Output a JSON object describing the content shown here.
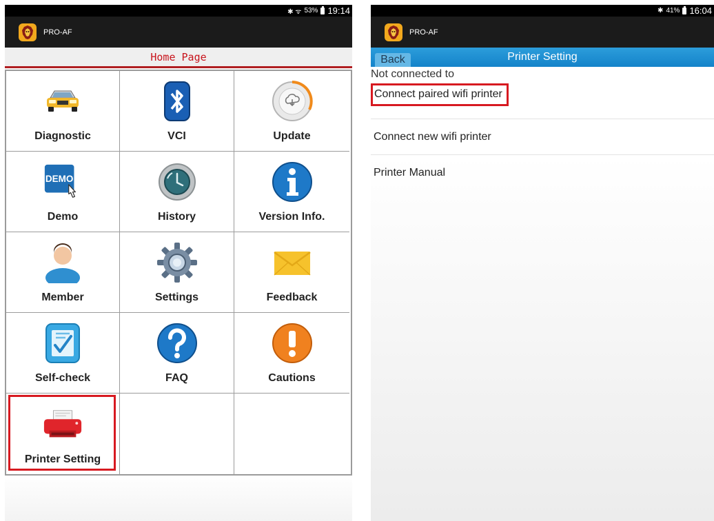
{
  "left": {
    "status": {
      "indicators": "✱ ᯤ",
      "battery": "53%",
      "time": "19:14"
    },
    "app_title": "PRO-AF",
    "page_title": "Home Page",
    "tiles": [
      {
        "name": "diagnostic",
        "label": "Diagnostic",
        "icon": "car-icon"
      },
      {
        "name": "vci",
        "label": "VCI",
        "icon": "bluetooth-icon"
      },
      {
        "name": "update",
        "label": "Update",
        "icon": "cloud-download-icon"
      },
      {
        "name": "demo",
        "label": "Demo",
        "icon": "demo-icon"
      },
      {
        "name": "history",
        "label": "History",
        "icon": "history-icon"
      },
      {
        "name": "version-info",
        "label": "Version Info.",
        "icon": "info-icon"
      },
      {
        "name": "member",
        "label": "Member",
        "icon": "person-icon"
      },
      {
        "name": "settings",
        "label": "Settings",
        "icon": "gear-icon"
      },
      {
        "name": "feedback",
        "label": "Feedback",
        "icon": "envelope-icon"
      },
      {
        "name": "self-check",
        "label": "Self-check",
        "icon": "checklist-icon"
      },
      {
        "name": "faq",
        "label": "FAQ",
        "icon": "question-icon"
      },
      {
        "name": "cautions",
        "label": "Cautions",
        "icon": "exclamation-icon"
      },
      {
        "name": "printer-setting",
        "label": "Printer Setting",
        "icon": "printer-icon"
      }
    ],
    "demo_badge": "DEMO"
  },
  "right": {
    "status": {
      "indicators": "✱",
      "battery": "41%",
      "time": "16:04"
    },
    "app_title": "PRO-AF",
    "back_label": "Back",
    "title": "Printer Setting",
    "connection_status": "Not connected to",
    "menu": [
      {
        "label": "Connect paired wifi printer"
      },
      {
        "label": "Connect new wifi printer"
      },
      {
        "label": "Printer Manual"
      }
    ]
  },
  "colors": {
    "accent_red": "#d71920",
    "title_red": "#c8141c",
    "bar_blue": "#1b8fd4"
  }
}
